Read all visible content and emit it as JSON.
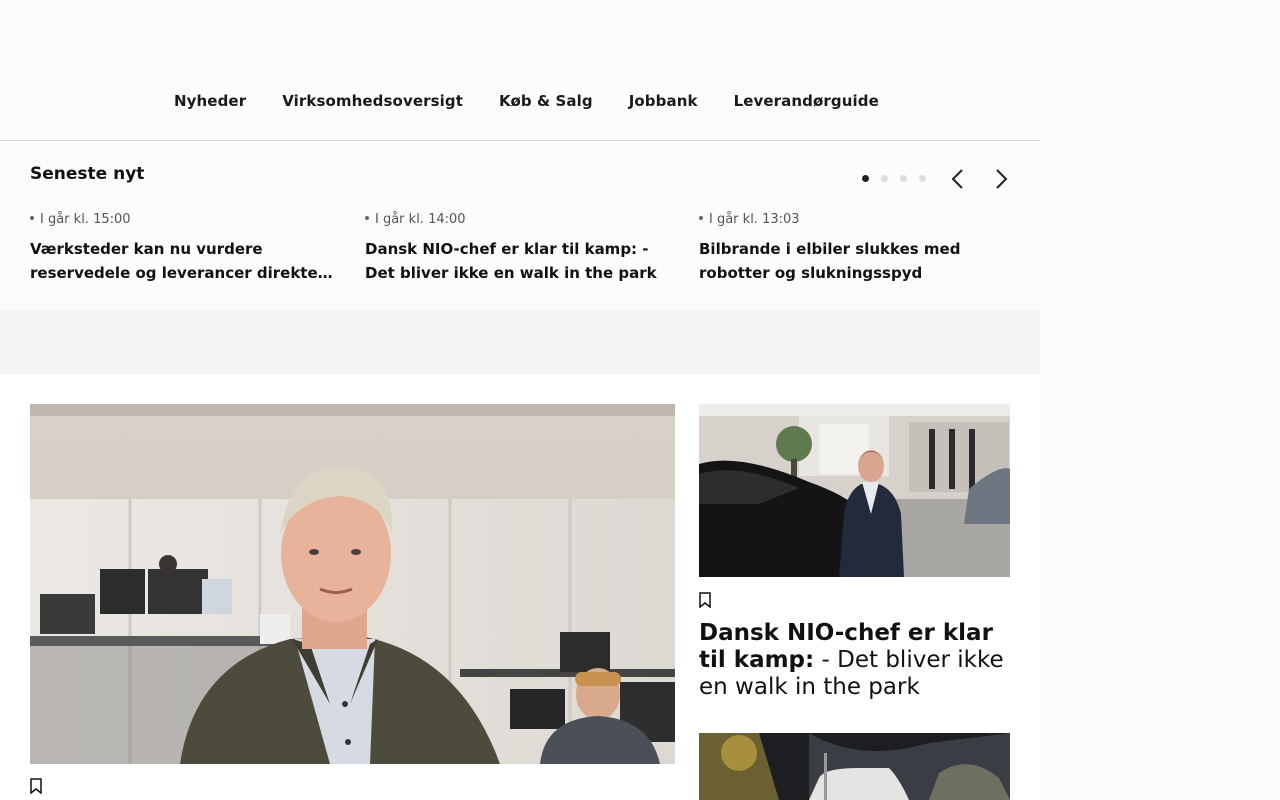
{
  "nav": {
    "items": [
      "Nyheder",
      "Virksomhedsoversigt",
      "Køb & Salg",
      "Jobbank",
      "Leverandørguide"
    ]
  },
  "latest": {
    "title": "Seneste nyt",
    "items": [
      {
        "time": "I går kl. 15:00",
        "headline": "Værksteder kan nu vurdere reservedele og leverancer direkte i..."
      },
      {
        "time": "I går kl. 14:00",
        "headline": "Dansk NIO-chef er klar til kamp: - Det bliver ikke en walk in the park"
      },
      {
        "time": "I går kl. 13:03",
        "headline": "Bilbrande i elbiler slukkes med robotter og slukningsspyd"
      }
    ],
    "pagination": {
      "pages": 4,
      "active": 1
    }
  },
  "featured": {
    "side_article": {
      "headline_bold": "Dansk NIO-chef er klar til kamp:",
      "headline_rest": " - Det bliver ikke en walk in the park"
    }
  },
  "icons": {
    "prev": "chevron-left-icon",
    "next": "chevron-right-icon",
    "bookmark": "bookmark-icon"
  }
}
